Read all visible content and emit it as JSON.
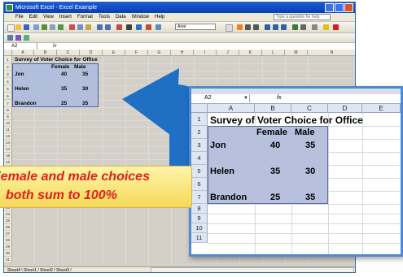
{
  "excel": {
    "title": "Microsoft Excel - Excel Example",
    "menu": [
      "File",
      "Edit",
      "View",
      "Insert",
      "Format",
      "Tools",
      "Data",
      "Window",
      "Help"
    ],
    "help_placeholder": "Type a question for help",
    "font_name": "Arial",
    "name_box": "A2",
    "fx_label": "fx",
    "column_headers": [
      "A",
      "B",
      "C",
      "D",
      "E",
      "F",
      "G",
      "H",
      "I",
      "J",
      "K",
      "L",
      "M",
      "N"
    ],
    "row_headers": [
      "1",
      "2",
      "3",
      "4",
      "5",
      "6",
      "7",
      "8",
      "9",
      "10",
      "11",
      "12",
      "13",
      "14",
      "15",
      "16",
      "17",
      "18",
      "19",
      "20",
      "21",
      "22",
      "23",
      "24",
      "25",
      "26",
      "27",
      "28",
      "29",
      "30",
      "31"
    ],
    "sheet_tabs": "Sheet4 \\ Sheet1 / Sheet2 / Sheet3 /"
  },
  "sheet": {
    "title": "Survey of Voter Choice for Office",
    "headers": [
      "Female",
      "Male"
    ],
    "rows": [
      {
        "name": "Jon",
        "female": "40",
        "male": "35"
      },
      {
        "name": "Helen",
        "female": "35",
        "male": "30"
      },
      {
        "name": "Brandon",
        "female": "25",
        "male": "35"
      }
    ]
  },
  "zoom": {
    "name_box": "A2",
    "fx_label": "fx",
    "column_headers": [
      "A",
      "B",
      "C",
      "D",
      "E"
    ],
    "row_headers": [
      "1",
      "2",
      "3",
      "4",
      "5",
      "6",
      "7",
      "8",
      "9",
      "10",
      "11"
    ]
  },
  "callout": {
    "line1": "Female and male choices",
    "line2": "both sum to 100%",
    "text_color": "#e0201c"
  },
  "colors": {
    "arrow": "#1f6fc4",
    "selection": "#b7c1dd",
    "zoom_border": "#4f8ad6"
  }
}
